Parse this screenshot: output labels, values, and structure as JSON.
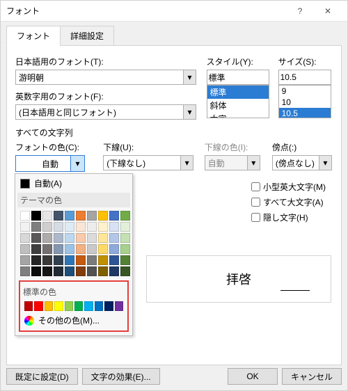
{
  "window": {
    "title": "フォント"
  },
  "tabs": {
    "font": "フォント",
    "advanced": "詳細設定"
  },
  "labels": {
    "jp_font": "日本語用のフォント(T):",
    "jp_font_value": "游明朝",
    "en_font": "英数字用のフォント(F):",
    "en_font_value": "(日本語用と同じフォント)",
    "style": "スタイル(Y):",
    "style_value": "標準",
    "size": "サイズ(S):",
    "size_value": "10.5",
    "all_text": "すべての文字列",
    "font_color": "フォントの色(C):",
    "font_color_value": "自動",
    "underline": "下線(U):",
    "underline_value": "(下線なし)",
    "ul_color": "下線の色(I):",
    "ul_color_value": "自動",
    "emphasis": "傍点(:)",
    "emphasis_value": "(傍点なし)",
    "small_caps": "小型英大文字(M)",
    "all_caps": "すべて大文字(A)",
    "hidden": "隠し文字(H)",
    "preview_text": "拝啓"
  },
  "style_options": [
    "標準",
    "斜体",
    "太字"
  ],
  "style_selected": "標準",
  "size_options": [
    "9",
    "10",
    "10.5"
  ],
  "size_selected": "10.5",
  "color_popup": {
    "auto": "自動(A)",
    "theme": "テーマの色",
    "standard": "標準の色",
    "more": "その他の色(M)..."
  },
  "theme_colors": [
    [
      "#ffffff",
      "#000000",
      "#e7e6e6",
      "#44546a",
      "#5b9bd5",
      "#ed7d31",
      "#a5a5a5",
      "#ffc000",
      "#4472c4",
      "#70ad47"
    ],
    [
      "#f2f2f2",
      "#7f7f7f",
      "#d0cece",
      "#d6dce4",
      "#deebf6",
      "#fbe5d5",
      "#ededed",
      "#fff2cc",
      "#d9e2f3",
      "#e2efd9"
    ],
    [
      "#d8d8d8",
      "#595959",
      "#aeabab",
      "#adb9ca",
      "#bdd7ee",
      "#f7cbac",
      "#dbdbdb",
      "#fee599",
      "#b4c6e7",
      "#c5e0b3"
    ],
    [
      "#bfbfbf",
      "#3f3f3f",
      "#757070",
      "#8496b0",
      "#9cc3e5",
      "#f4b183",
      "#c9c9c9",
      "#ffd965",
      "#8eaadb",
      "#a8d08d"
    ],
    [
      "#a5a5a5",
      "#262626",
      "#3a3838",
      "#323f4f",
      "#2e75b5",
      "#c55a11",
      "#7b7b7b",
      "#bf9000",
      "#2f5496",
      "#538135"
    ],
    [
      "#7f7f7f",
      "#0c0c0c",
      "#171616",
      "#222a35",
      "#1e4e79",
      "#833c0b",
      "#525252",
      "#7f6000",
      "#1f3864",
      "#375623"
    ]
  ],
  "standard_colors": [
    "#c00000",
    "#ff0000",
    "#ffc000",
    "#ffff00",
    "#92d050",
    "#00b050",
    "#00b0f0",
    "#0070c0",
    "#002060",
    "#7030a0"
  ],
  "buttons": {
    "set_default": "既定に設定(D)",
    "text_effects": "文字の効果(E)...",
    "ok": "OK",
    "cancel": "キャンセル"
  }
}
